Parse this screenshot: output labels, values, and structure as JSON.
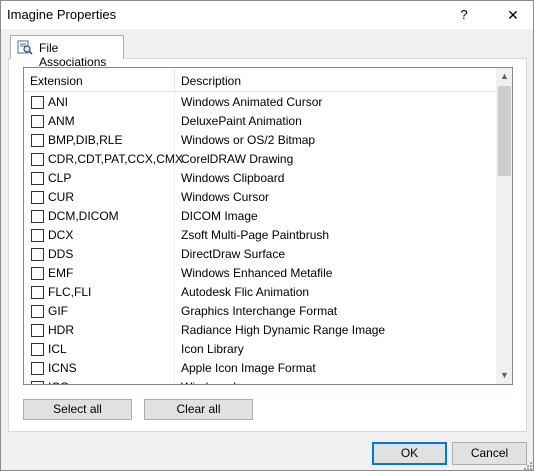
{
  "window": {
    "title": "Imagine Properties",
    "help_glyph": "?",
    "close_glyph": "✕"
  },
  "tabs": [
    {
      "label": "File Associations",
      "icon": "file-associations-icon"
    }
  ],
  "list": {
    "columns": [
      "Extension",
      "Description"
    ],
    "rows": [
      {
        "ext": "ANI",
        "desc": "Windows Animated Cursor",
        "checked": false
      },
      {
        "ext": "ANM",
        "desc": "DeluxePaint Animation",
        "checked": false
      },
      {
        "ext": "BMP,DIB,RLE",
        "desc": "Windows or OS/2 Bitmap",
        "checked": false
      },
      {
        "ext": "CDR,CDT,PAT,CCX,CMX",
        "desc": "CorelDRAW Drawing",
        "checked": false
      },
      {
        "ext": "CLP",
        "desc": "Windows Clipboard",
        "checked": false
      },
      {
        "ext": "CUR",
        "desc": "Windows Cursor",
        "checked": false
      },
      {
        "ext": "DCM,DICOM",
        "desc": "DICOM Image",
        "checked": false
      },
      {
        "ext": "DCX",
        "desc": "Zsoft Multi-Page Paintbrush",
        "checked": false
      },
      {
        "ext": "DDS",
        "desc": "DirectDraw Surface",
        "checked": false
      },
      {
        "ext": "EMF",
        "desc": "Windows Enhanced Metafile",
        "checked": false
      },
      {
        "ext": "FLC,FLI",
        "desc": "Autodesk Flic Animation",
        "checked": false
      },
      {
        "ext": "GIF",
        "desc": "Graphics Interchange Format",
        "checked": false
      },
      {
        "ext": "HDR",
        "desc": "Radiance High Dynamic Range Image",
        "checked": false
      },
      {
        "ext": "ICL",
        "desc": "Icon Library",
        "checked": false
      },
      {
        "ext": "ICNS",
        "desc": "Apple Icon Image Format",
        "checked": false
      },
      {
        "ext": "ICO",
        "desc": "Windows Icon",
        "checked": false
      }
    ]
  },
  "buttons": {
    "select_all": "Select all",
    "clear_all": "Clear all",
    "ok": "OK",
    "cancel": "Cancel"
  },
  "colors": {
    "accent": "#0078d7",
    "window_bg": "#f0f0f0"
  }
}
